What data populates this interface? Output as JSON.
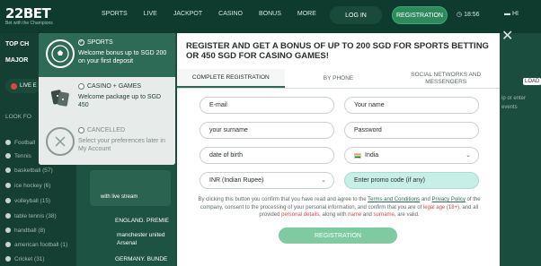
{
  "header": {
    "logo_main": "22BET",
    "logo_tagline": "Bet with the Champions",
    "nav": [
      "SPORTS",
      "LIVE",
      "JACKPOT",
      "CASINO",
      "BONUS",
      "MORE"
    ],
    "login_label": "LOG IN",
    "register_label": "REGISTRATION",
    "time": "18:56",
    "lang": "HI"
  },
  "left_sidebar": {
    "top_label": "TOP CH",
    "major_label": "MAJOR",
    "live_label": "LIVE E",
    "look_label": "LOOK FO",
    "sports": [
      "Football",
      "Tennis",
      "basketball (57)",
      "ice hockey (6)",
      "volleyball (15)",
      "table tennis (38)",
      "handball (8)",
      "american football (1)",
      "Cricket (31)"
    ]
  },
  "middle": {
    "with_live_stream": "with live stream",
    "league1": "ENGLAND. PREMIE",
    "team1": "manchester united",
    "team2": "Arsenal",
    "league2": "GERMANY. BUNDE"
  },
  "offers": [
    {
      "title": "SPORTS",
      "desc": "Welcome bonus up to SGD 200 on your first deposit",
      "icon": "football-icon",
      "selected": true
    },
    {
      "title": "CASINO + GAMES",
      "desc": "Welcome package up to SGD 450",
      "icon": "casino-icon",
      "selected": false
    },
    {
      "title": "CANCELLED",
      "desc": "Select your preferences later in My Account",
      "icon": "cancel-icon",
      "selected": false
    }
  ],
  "modal": {
    "title": "REGISTER AND GET A BONUS OF UP TO 200 SGD FOR SPORTS BETTING OR 450 SGD FOR CASINO GAMES!",
    "tabs": [
      "COMPLETE REGISTRATION",
      "BY PHONE",
      "SOCIAL NETWORKS AND MESSENGERS"
    ],
    "email_placeholder": "E-mail",
    "name_placeholder": "Your name",
    "surname_placeholder": "your surname",
    "password_placeholder": "Password",
    "dob_placeholder": "date of birth",
    "country_value": "India",
    "currency_value": "INR (Indian Rupee)",
    "promo_placeholder": "Enter promo code (if any)",
    "terms_part1": "By clicking this button you confirm that you have read and agree to the ",
    "terms_link1": "Terms and Conditions",
    "terms_and": " and ",
    "terms_link2": "Privacy Policy",
    "terms_part2": " of the company, consent to the processing of your personal information, and confirm that you are of ",
    "terms_legal": "legal age (18+)",
    "terms_part3": ", and all provided ",
    "terms_details": "personal details",
    "terms_part4": ", along with ",
    "terms_name": "name",
    "terms_and2": " and ",
    "terms_surname": "surname",
    "terms_part5": ", are valid.",
    "register_button": "REGISTRATION"
  },
  "right_sidebar": {
    "items": [
      "ip or enter",
      "LOAD",
      "events"
    ]
  },
  "colors": {
    "header_bg": "#0e3b2e",
    "accent": "#2e6b57",
    "register_btn": "#7fcba1",
    "promo_field": "#c8efe7"
  }
}
